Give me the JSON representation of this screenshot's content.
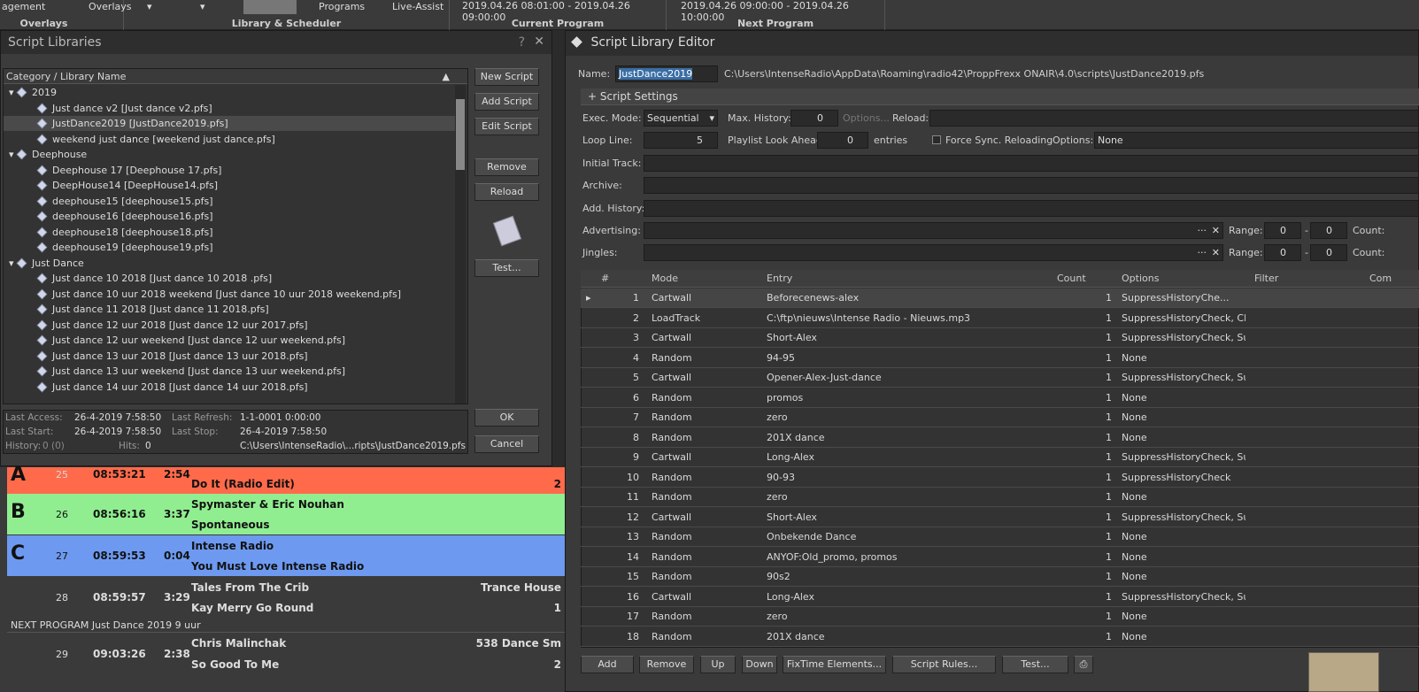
{
  "ribbon": {
    "management": "agement",
    "overlays_btn": "Overlays",
    "overlays_label": "Overlays",
    "programs_btn": "Programs",
    "live_assist": "Live-Assist",
    "library_scheduler": "Library & Scheduler",
    "current_time": "2019.04.26 08:01:00 - 2019.04.26 09:00:00",
    "current_label": "Current Program",
    "next_time": "2019.04.26 09:00:00 - 2019.04.26 10:00:00",
    "next_label": "Next Program"
  },
  "playlist": {
    "rows": [
      {
        "letter": "A",
        "num": "25",
        "time": "08:53:21",
        "dur": "2:54",
        "line2": "Do It (Radio Edit)",
        "right2": "2"
      },
      {
        "letter": "B",
        "num": "26",
        "time": "08:56:16",
        "dur": "3:37",
        "line1": "Spymaster & Eric Nouhan",
        "line2": "Spontaneous"
      },
      {
        "letter": "C",
        "num": "27",
        "time": "08:59:53",
        "dur": "0:04",
        "line1": "Intense Radio",
        "line2": "You Must Love Intense Radio"
      },
      {
        "num": "28",
        "time": "08:59:57",
        "dur": "3:29",
        "line1": "Tales From The Crib",
        "line2": "Kay Merry Go Round",
        "cat": "Trance House",
        "right2": "1"
      },
      {
        "num": "29",
        "time": "09:03:26",
        "dur": "2:38",
        "line1": "Chris Malinchak",
        "line2": "So Good To Me",
        "cat": "538 Dance Sm",
        "right2": "2"
      }
    ],
    "next_program": "NEXT PROGRAM Just Dance 2019 9 uur",
    "colors": {
      "a": "#ff6a4a",
      "b": "#90ee90",
      "c": "#6d9af0"
    }
  },
  "libraries": {
    "title": "Script Libraries",
    "help": "?",
    "close": "✕",
    "column_header": "Category / Library Name",
    "tree": [
      {
        "type": "cat",
        "label": "2019"
      },
      {
        "type": "item",
        "label": "Just dance v2 [Just dance v2.pfs]"
      },
      {
        "type": "item",
        "label": "JustDance2019 [JustDance2019.pfs]",
        "selected": true
      },
      {
        "type": "item",
        "label": "weekend just dance [weekend just dance.pfs]"
      },
      {
        "type": "cat",
        "label": "Deephouse"
      },
      {
        "type": "item",
        "label": "Deephouse 17 [Deephouse 17.pfs]"
      },
      {
        "type": "item",
        "label": "DeepHouse14 [DeepHouse14.pfs]"
      },
      {
        "type": "item",
        "label": "deephouse15 [deephouse15.pfs]"
      },
      {
        "type": "item",
        "label": "deephouse16 [deephouse16.pfs]"
      },
      {
        "type": "item",
        "label": "deephouse18 [deephouse18.pfs]"
      },
      {
        "type": "item",
        "label": "deephouse19 [deephouse19.pfs]"
      },
      {
        "type": "cat",
        "label": "Just Dance"
      },
      {
        "type": "item",
        "label": "Just dance 10 2018  [Just dance 10 2018 .pfs]"
      },
      {
        "type": "item",
        "label": "Just dance 10 uur 2018 weekend [Just dance 10 uur 2018 weekend.pfs]"
      },
      {
        "type": "item",
        "label": "Just dance 11 2018 [Just dance 11 2018.pfs]"
      },
      {
        "type": "item",
        "label": "Just dance 12 uur 2018 [Just dance 12 uur 2017.pfs]"
      },
      {
        "type": "item",
        "label": "Just dance 12 uur weekend [Just dance 12 uur weekend.pfs]"
      },
      {
        "type": "item",
        "label": "Just dance 13 uur 2018 [Just dance 13 uur 2018.pfs]"
      },
      {
        "type": "item",
        "label": "Just dance 13 uur weekend [Just dance 13 uur weekend.pfs]"
      },
      {
        "type": "item",
        "label": "Just dance 14 uur 2018 [Just dance 14 uur 2018.pfs]"
      }
    ],
    "buttons": {
      "new": "New Script",
      "add": "Add Script",
      "edit": "Edit Script",
      "remove": "Remove",
      "reload": "Reload",
      "test": "Test...",
      "ok": "OK",
      "cancel": "Cancel"
    },
    "info": {
      "last_access_l": "Last Access:",
      "last_access": "26-4-2019 7:58:50",
      "last_refresh_l": "Last Refresh:",
      "last_refresh": "1-1-0001 0:00:00",
      "last_start_l": "Last Start:",
      "last_start": "26-4-2019 7:58:50",
      "last_stop_l": "Last Stop:",
      "last_stop": "26-4-2019 7:58:50",
      "history_l": "History:",
      "history": "0 (0)",
      "hits_l": "Hits:",
      "hits": "0",
      "path": "C:\\Users\\IntenseRadio\\...ripts\\JustDance2019.pfs"
    }
  },
  "editor": {
    "title": "Script Library Editor",
    "name_l": "Name:",
    "name": "JustDance2019",
    "path": "C:\\Users\\IntenseRadio\\AppData\\Roaming\\radio42\\ProppFrexx ONAIR\\4.0\\scripts\\JustDance2019.pfs",
    "settings_header": "+ Script Settings",
    "exec_mode_l": "Exec. Mode:",
    "exec_mode": "Sequential",
    "max_history_l": "Max. History:",
    "max_history": "0",
    "options_btn": "Options...",
    "reload_l": "Reload:",
    "loop_line_l": "Loop Line:",
    "loop_line": "5",
    "lookahead_l": "Playlist Look Ahead:",
    "lookahead": "0",
    "entries_l": "entries",
    "force_sync": "Force Sync. Reloading",
    "options_l": "Options:",
    "options": "None",
    "initial_track_l": "Initial Track:",
    "archive_l": "Archive:",
    "add_history_l": "Add. History:",
    "advertising_l": "Advertising:",
    "jingles_l": "Jingles:",
    "range_l": "Range:",
    "count_l": "Count:",
    "range_from": "0",
    "range_to": "0",
    "columns": {
      "num": "#",
      "mode": "Mode",
      "entry": "Entry",
      "count": "Count",
      "options": "Options",
      "filter": "Filter",
      "comment": "Com"
    },
    "rows": [
      {
        "n": "1",
        "mode": "Cartwall",
        "entry": "Beforecenews-alex",
        "count": "1",
        "options": "SuppressHistoryChe..."
      },
      {
        "n": "2",
        "mode": "LoadTrack",
        "entry": "C:\\ftp\\nieuws\\Intense Radio - Nieuws.mp3",
        "count": "1",
        "options": "SuppressHistoryCheck, Clea..."
      },
      {
        "n": "3",
        "mode": "Cartwall",
        "entry": "Short-Alex",
        "count": "1",
        "options": "SuppressHistoryCheck, Sup..."
      },
      {
        "n": "4",
        "mode": "Random",
        "entry": "94-95",
        "count": "1",
        "options": "None"
      },
      {
        "n": "5",
        "mode": "Cartwall",
        "entry": "Opener-Alex-Just-dance",
        "count": "1",
        "options": "SuppressHistoryCheck, Sup..."
      },
      {
        "n": "6",
        "mode": "Random",
        "entry": "promos",
        "count": "1",
        "options": "None"
      },
      {
        "n": "7",
        "mode": "Random",
        "entry": "zero",
        "count": "1",
        "options": "None"
      },
      {
        "n": "8",
        "mode": "Random",
        "entry": "201X dance",
        "count": "1",
        "options": "None"
      },
      {
        "n": "9",
        "mode": "Cartwall",
        "entry": "Long-Alex",
        "count": "1",
        "options": "SuppressHistoryCheck, Sup..."
      },
      {
        "n": "10",
        "mode": "Random",
        "entry": "90-93",
        "count": "1",
        "options": "SuppressHistoryCheck"
      },
      {
        "n": "11",
        "mode": "Random",
        "entry": "zero",
        "count": "1",
        "options": "None"
      },
      {
        "n": "12",
        "mode": "Cartwall",
        "entry": "Short-Alex",
        "count": "1",
        "options": "SuppressHistoryCheck, Sup..."
      },
      {
        "n": "13",
        "mode": "Random",
        "entry": "Onbekende Dance",
        "count": "1",
        "options": "None"
      },
      {
        "n": "14",
        "mode": "Random",
        "entry": "ANYOF:Old_promo, promos",
        "count": "1",
        "options": "None"
      },
      {
        "n": "15",
        "mode": "Random",
        "entry": "90s2",
        "count": "1",
        "options": "None"
      },
      {
        "n": "16",
        "mode": "Cartwall",
        "entry": "Long-Alex",
        "count": "1",
        "options": "SuppressHistoryCheck, Sup..."
      },
      {
        "n": "17",
        "mode": "Random",
        "entry": "zero",
        "count": "1",
        "options": "None"
      },
      {
        "n": "18",
        "mode": "Random",
        "entry": "201X dance",
        "count": "1",
        "options": "None"
      }
    ],
    "buttons": {
      "add": "Add",
      "remove": "Remove",
      "up": "Up",
      "down": "Down",
      "fixtime": "FixTime Elements...",
      "rules": "Script Rules...",
      "test": "Test..."
    }
  }
}
